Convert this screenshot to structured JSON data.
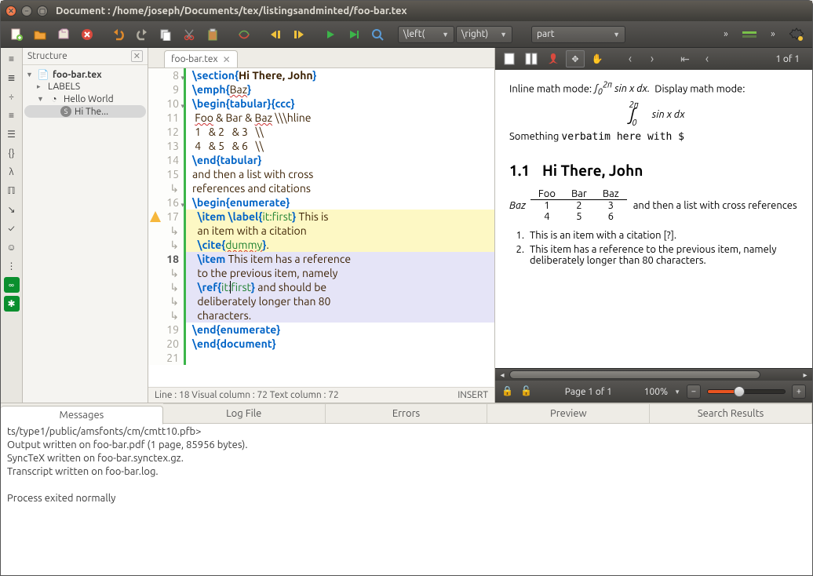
{
  "window": {
    "title": "Document : /home/joseph/Documents/tex/listingsandminted/foo-bar.tex"
  },
  "toolbar": {
    "combo_left": "\\left(",
    "combo_right": "\\right)",
    "combo_part": "part"
  },
  "structure": {
    "title": "Structure",
    "root": "foo-bar.tex",
    "labels": "LABELS",
    "section1": "Hello World",
    "section2": "Hi The..."
  },
  "editor": {
    "tab": "foo-bar.tex",
    "status_left": "Line : 18 Visual column : 72 Text column : 72",
    "status_right": "INSERT",
    "lines": {
      "8": {
        "pre": "\\section{",
        "body": "Hi There, John",
        "post": "}"
      },
      "9a": "\\emph{",
      "9b": "Baz",
      "9c": "}",
      "10": {
        "begin": "\\begin{",
        "env": "tabular",
        "rest": "}{ccc}"
      },
      "11a": "Foo",
      "11b": " & ",
      "11c": "Bar",
      "11d": " & ",
      "11e": "Baz",
      "11f": " \\\\\\hline",
      "12": " 1   & 2   & 3   \\\\",
      "13": " 4   & 5   & 6   \\\\",
      "14": {
        "end": "\\end{",
        "env": "tabular",
        "post": "}"
      },
      "15a": "and then a list with cross",
      "15b": "references and citations",
      "16": {
        "begin": "\\begin{",
        "env": "enumerate",
        "post": "}"
      },
      "17a": "  \\item",
      "17b": " \\label{",
      "17c": "it:first",
      "17d": "} This is",
      "17e": "  an item with a citation",
      "17f": "  \\cite{",
      "17g": "dummy",
      "17h": "}.",
      "18a": "  \\item",
      "18b": " This item has a reference",
      "18c": "  to the previous item, namely",
      "18d": "  \\ref{",
      "18e1": "it:",
      "18e2": "first",
      "18f": "} and should be",
      "18g": "  deliberately longer than 80",
      "18h": "  characters.",
      "19": {
        "end": "\\end{",
        "env": "enumerate",
        "post": "}"
      },
      "20": {
        "end": "\\end{",
        "env": "document",
        "post": "}"
      }
    }
  },
  "pdf": {
    "pages": "1 of 1",
    "status_page": "Page 1 of 1",
    "status_zoom": "100%",
    "inline_label": "Inline math mode:",
    "display_label": "Display math mode:",
    "something": "Something ",
    "verbatim": "verbatim here with $",
    "sec_no": "1.1",
    "sec_title": "Hi There, John",
    "table": {
      "h1": "Foo",
      "h2": "Bar",
      "h3": "Baz",
      "r1": [
        "1",
        "2",
        "3"
      ],
      "r2": [
        "4",
        "5",
        "6"
      ],
      "side": "Baz"
    },
    "after_table": "and then a list with cross references",
    "li1": "This is an item with a citation [?].",
    "li2": "This item has a reference to the previous item, namely deliberately longer than 80 characters."
  },
  "bottom": {
    "tabs": {
      "messages": "Messages",
      "logfile": "Log File",
      "errors": "Errors",
      "preview": "Preview",
      "search": "Search Results"
    },
    "log0": "ts/type1/public/amsfonts/cm/cmtt10.pfb>",
    "log1": "Output written on foo-bar.pdf (1 page, 85956 bytes).",
    "log2": "SyncTeX written on foo-bar.synctex.gz.",
    "log3": "Transcript written on foo-bar.log.",
    "log4": "Process exited normally"
  }
}
